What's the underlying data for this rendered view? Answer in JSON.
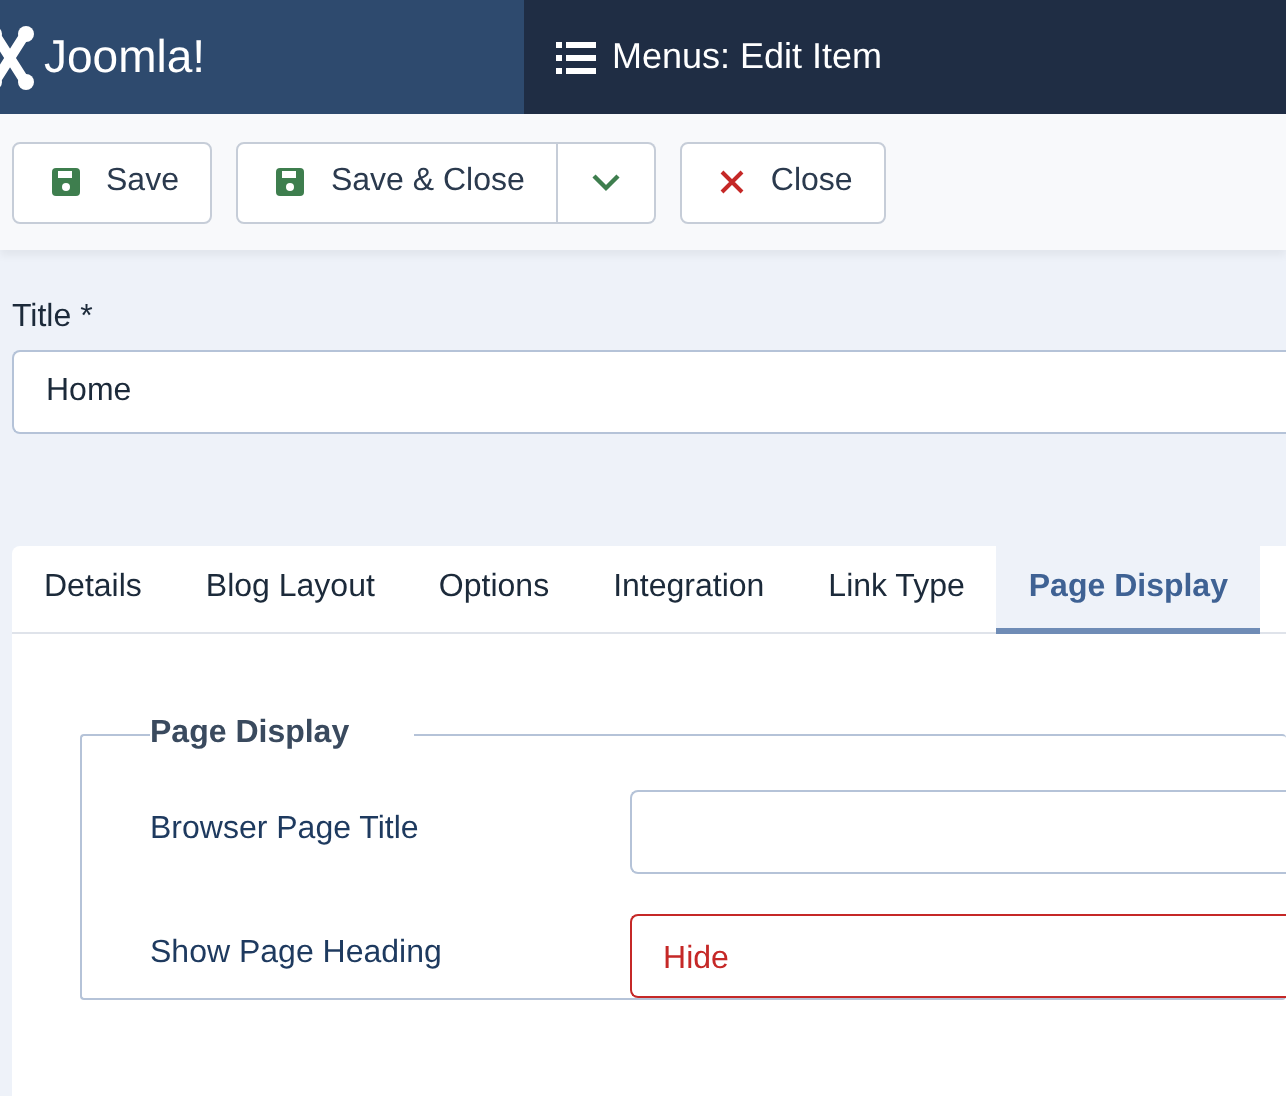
{
  "header": {
    "logo_text": "Joomla!",
    "title": "Menus: Edit Item"
  },
  "toolbar": [
    {
      "label": "Save",
      "kind": "save",
      "split": false
    },
    {
      "label": "Save & Close",
      "kind": "save",
      "split": true
    },
    {
      "label": "Close",
      "kind": "close",
      "split": false
    }
  ],
  "title_field": {
    "label": "Title *",
    "value": "Home"
  },
  "tabs": [
    {
      "label": "Details",
      "selected": false
    },
    {
      "label": "Blog Layout",
      "selected": false
    },
    {
      "label": "Options",
      "selected": false
    },
    {
      "label": "Integration",
      "selected": false
    },
    {
      "label": "Link Type",
      "selected": false
    },
    {
      "label": "Page Display",
      "selected": true
    }
  ],
  "fieldset": {
    "legend": "Page Display",
    "fields": [
      {
        "label": "Browser Page Title",
        "kind": "text"
      },
      {
        "label": "Show Page Heading",
        "kind": "select",
        "value": "Hide",
        "alert": true
      }
    ]
  }
}
